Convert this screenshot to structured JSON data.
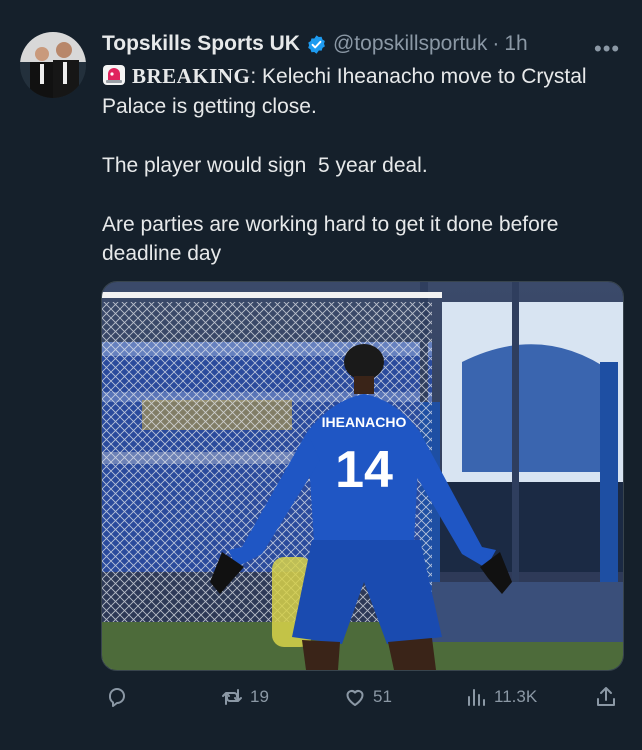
{
  "tweet": {
    "author": {
      "name": "Topskills Sports UK",
      "handle": "@topskillsportuk",
      "separator": "·",
      "time": "1h"
    },
    "more_label": "•••",
    "text": {
      "breaking_label": "BREAKING",
      "line1_rest": ": Kelechi Iheanacho move to Crystal Palace is getting close.",
      "line2": "The player would sign  5 year deal.",
      "line3": "Are parties are working hard to get it done before deadline day"
    },
    "media": {
      "jersey_name": "IHEANACHO",
      "jersey_number": "14"
    },
    "actions": {
      "reply_count": "",
      "retweet_count": "19",
      "like_count": "51",
      "views_count": "11.3K"
    }
  },
  "colors": {
    "background": "#15202b",
    "text": "#e7e9ea",
    "muted": "#8b98a5",
    "verified": "#1d9bf0"
  },
  "icons": [
    "verified-badge-icon",
    "siren-icon",
    "more-icon",
    "reply-icon",
    "retweet-icon",
    "like-icon",
    "views-icon",
    "share-icon"
  ]
}
